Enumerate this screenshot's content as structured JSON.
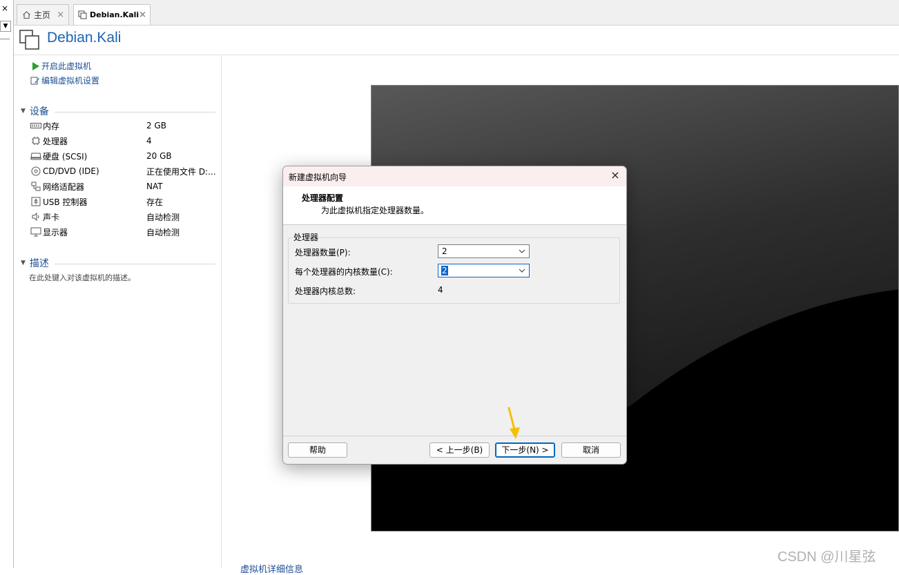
{
  "left_strip": {
    "close_glyph": "×",
    "dropdown_glyph": "▼"
  },
  "tabs": [
    {
      "label": "主页",
      "icon": "home-icon",
      "close": "×"
    },
    {
      "label": "Debian.Kali",
      "icon": "vm-icon",
      "close": "×"
    }
  ],
  "header": {
    "title": "Debian.Kali",
    "icon": "vm-icon"
  },
  "actions": [
    {
      "label": "开启此虚拟机",
      "icon": "play-icon"
    },
    {
      "label": "编辑虚拟机设置",
      "icon": "edit-icon"
    }
  ],
  "devices_section": {
    "title": "设备",
    "items": [
      {
        "name": "内存",
        "value": "2 GB",
        "icon": "memory-icon"
      },
      {
        "name": "处理器",
        "value": "4",
        "icon": "cpu-icon"
      },
      {
        "name": "硬盘 (SCSI)",
        "value": "20 GB",
        "icon": "harddisk-icon"
      },
      {
        "name": "CD/DVD (IDE)",
        "value": "正在使用文件 D:...",
        "icon": "cd-icon"
      },
      {
        "name": "网络适配器",
        "value": "NAT",
        "icon": "network-icon"
      },
      {
        "name": "USB 控制器",
        "value": "存在",
        "icon": "usb-icon"
      },
      {
        "name": "声卡",
        "value": "自动检测",
        "icon": "sound-icon"
      },
      {
        "name": "显示器",
        "value": "自动检测",
        "icon": "monitor-icon"
      }
    ]
  },
  "description_section": {
    "title": "描述",
    "placeholder": "在此处键入对该虚拟机的描述。"
  },
  "dialog": {
    "title": "新建虚拟机向导",
    "close": "×",
    "heading": "处理器配置",
    "subheading": "为此虚拟机指定处理器数量。",
    "group_label": "处理器",
    "fields": {
      "processor_count_label": "处理器数量(P):",
      "processor_count_value": "2",
      "cores_per_processor_label": "每个处理器的内核数量(C):",
      "cores_per_processor_value": "2",
      "total_cores_label": "处理器内核总数:",
      "total_cores_value": "4"
    },
    "buttons": {
      "help": "帮助",
      "back": "< 上一步(B)",
      "next": "下一步(N) >",
      "cancel": "取消"
    }
  },
  "bottom_link": "虚拟机详细信息",
  "watermark": "CSDN @川星弦",
  "colors": {
    "accent": "#1c62b4",
    "link": "#1c4e93",
    "annotation_arrow": "#f5c000",
    "selection": "#0a64c8"
  }
}
